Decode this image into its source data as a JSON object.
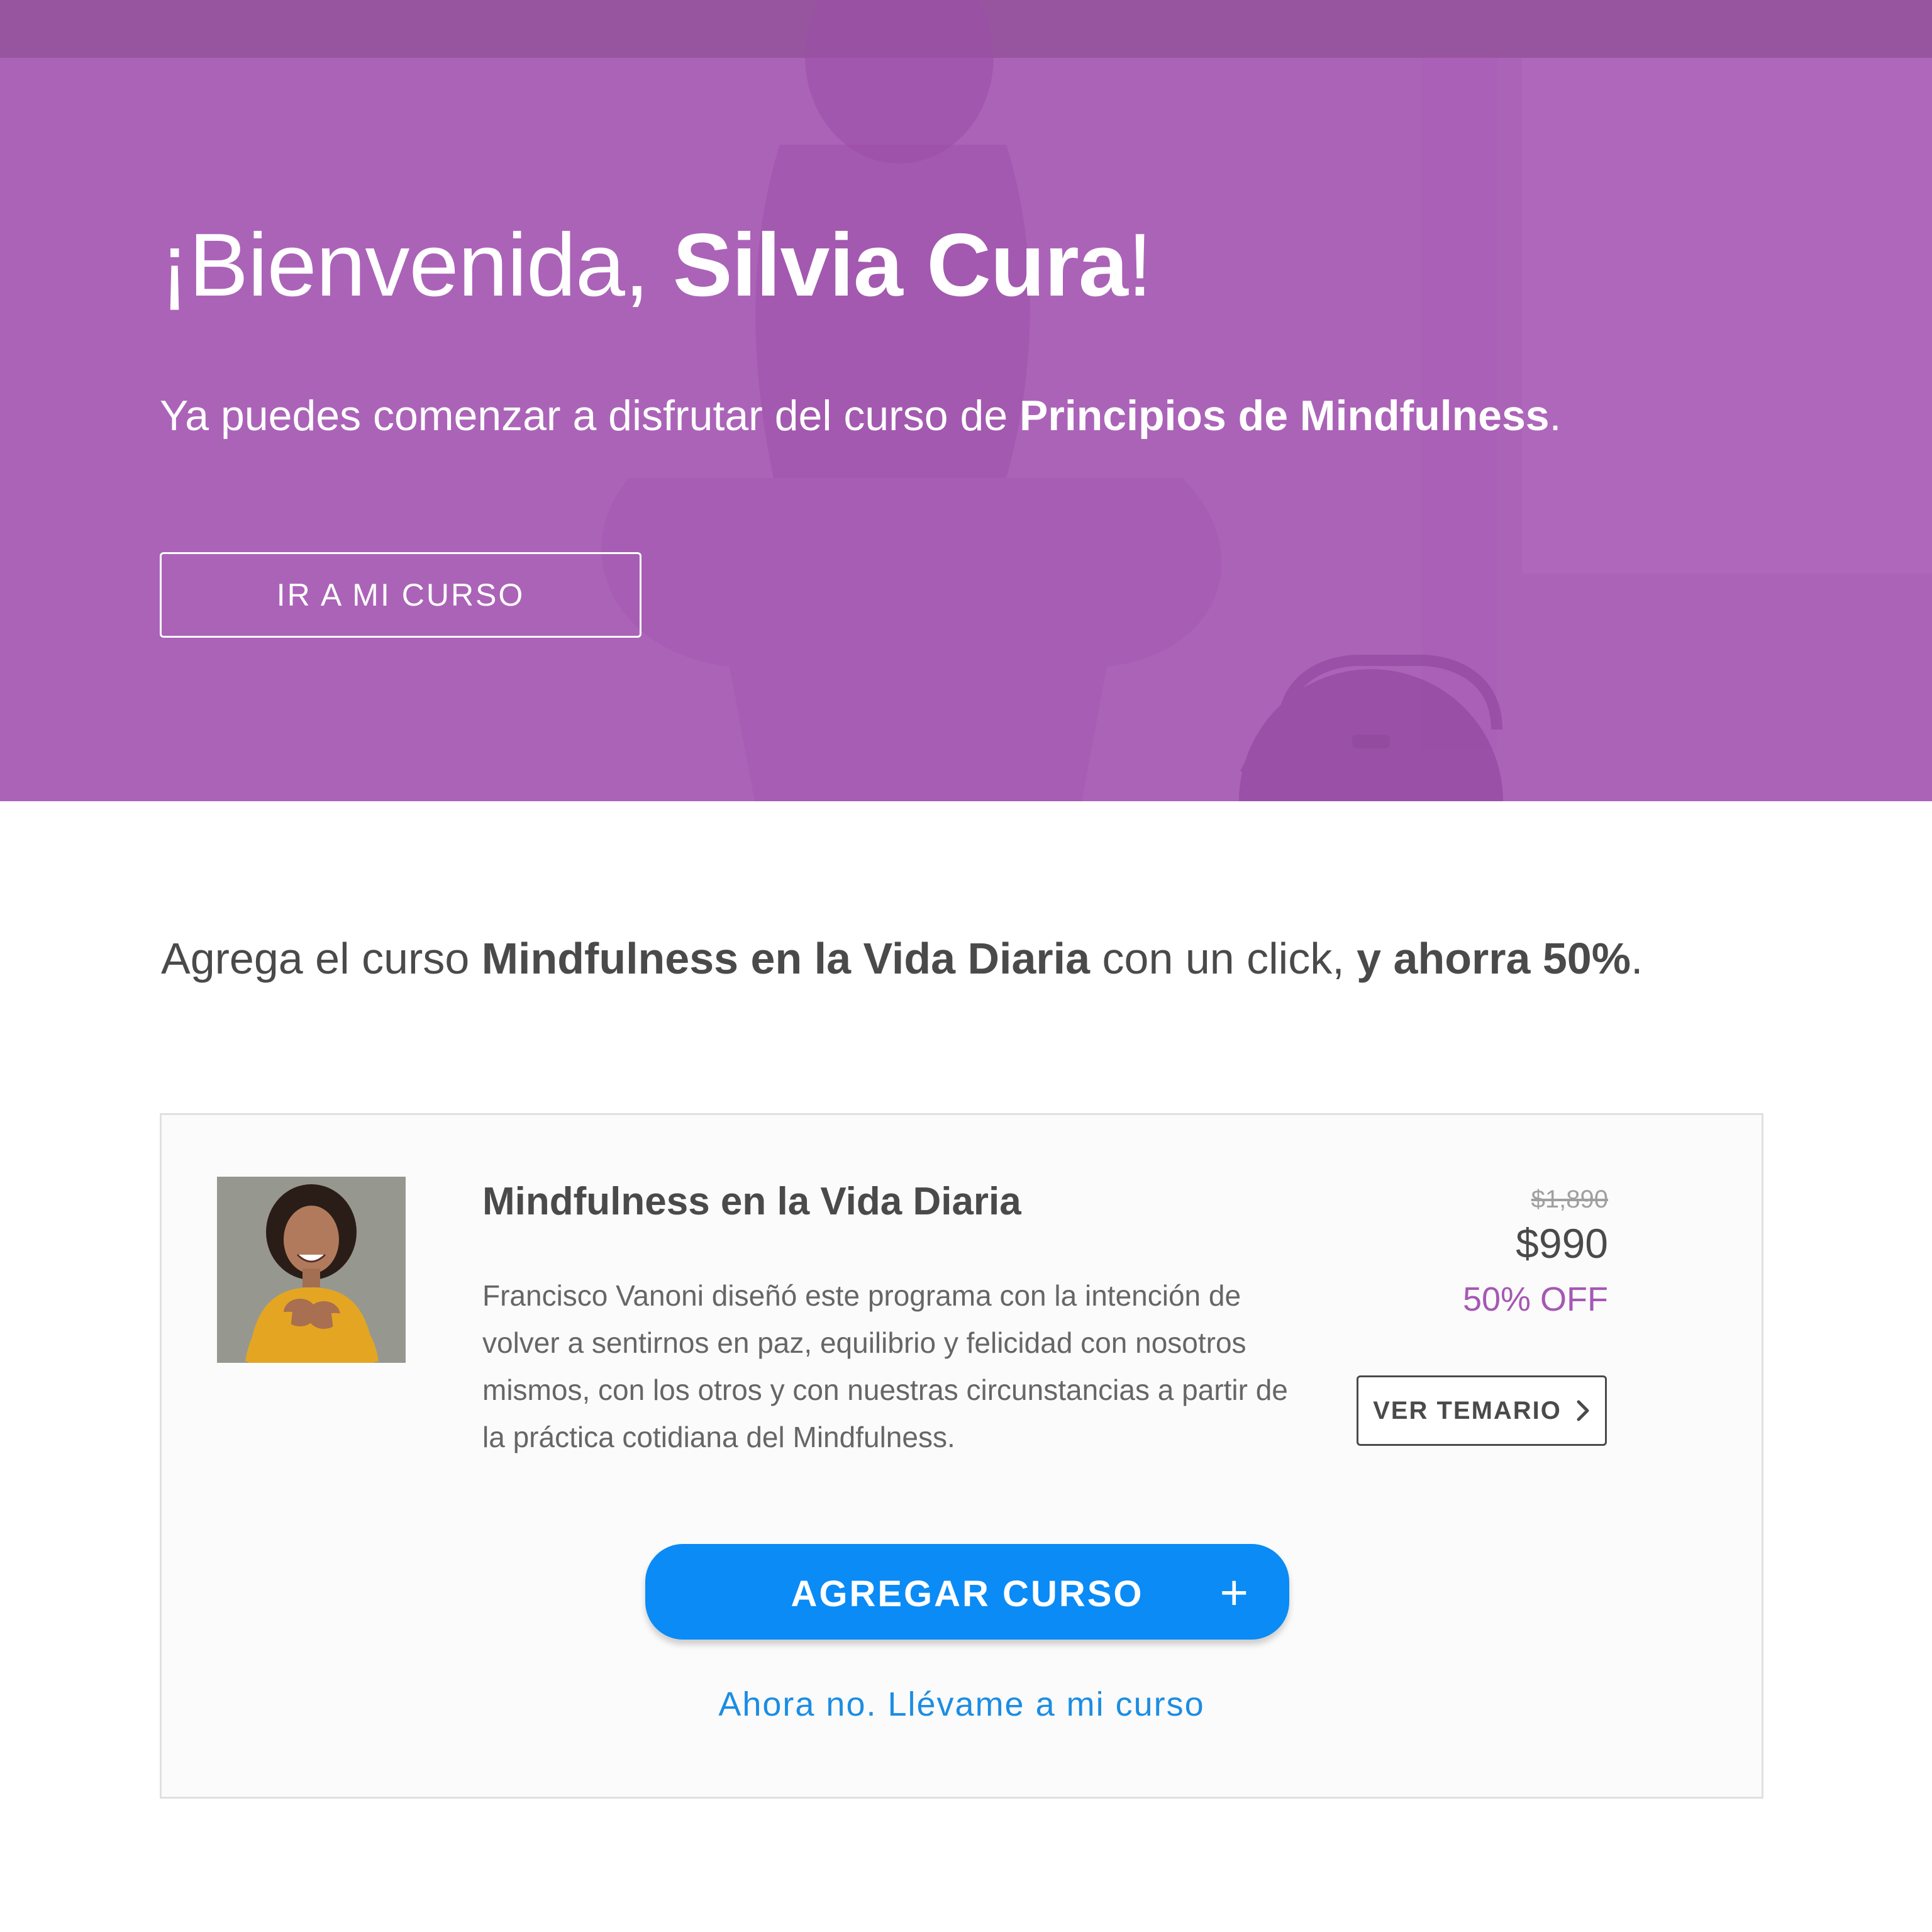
{
  "hero": {
    "greeting_prefix": "¡Bienvenida, ",
    "user_name": "Silvia Cura",
    "greeting_suffix": "!",
    "subtitle_prefix": "Ya puedes comenzar a disfrutar del curso de ",
    "course_name": "Principios de Mindfulness",
    "subtitle_suffix": ".",
    "button_label": "IR A MI CURSO"
  },
  "promo": {
    "prefix": "Agrega el curso ",
    "course_name": "Mindfulness en la Vida Diaria",
    "middle": " con un click, ",
    "highlight": "y ahorra 50%",
    "suffix": "."
  },
  "offer": {
    "title": "Mindfulness en la Vida Diaria",
    "description": "Francisco Vanoni diseñó este programa con la intención de volver a sentirnos en paz, equilibrio y felicidad con nosotros mismos, con los otros y con nuestras circunstancias a partir de la práctica cotidiana del Mindfulness.",
    "price_original": "$1,890",
    "price_current": "$990",
    "discount": "50% OFF",
    "syllabus_button": "VER TEMARIO",
    "add_button": "AGREGAR CURSO",
    "add_icon": "+",
    "skip_link": "Ahora no. Llévame a mi curso"
  },
  "colors": {
    "hero_purple": "#ab63b8",
    "accent_purple": "#a558b4",
    "primary_blue": "#0a8bf5",
    "link_blue": "#1c8de3"
  }
}
